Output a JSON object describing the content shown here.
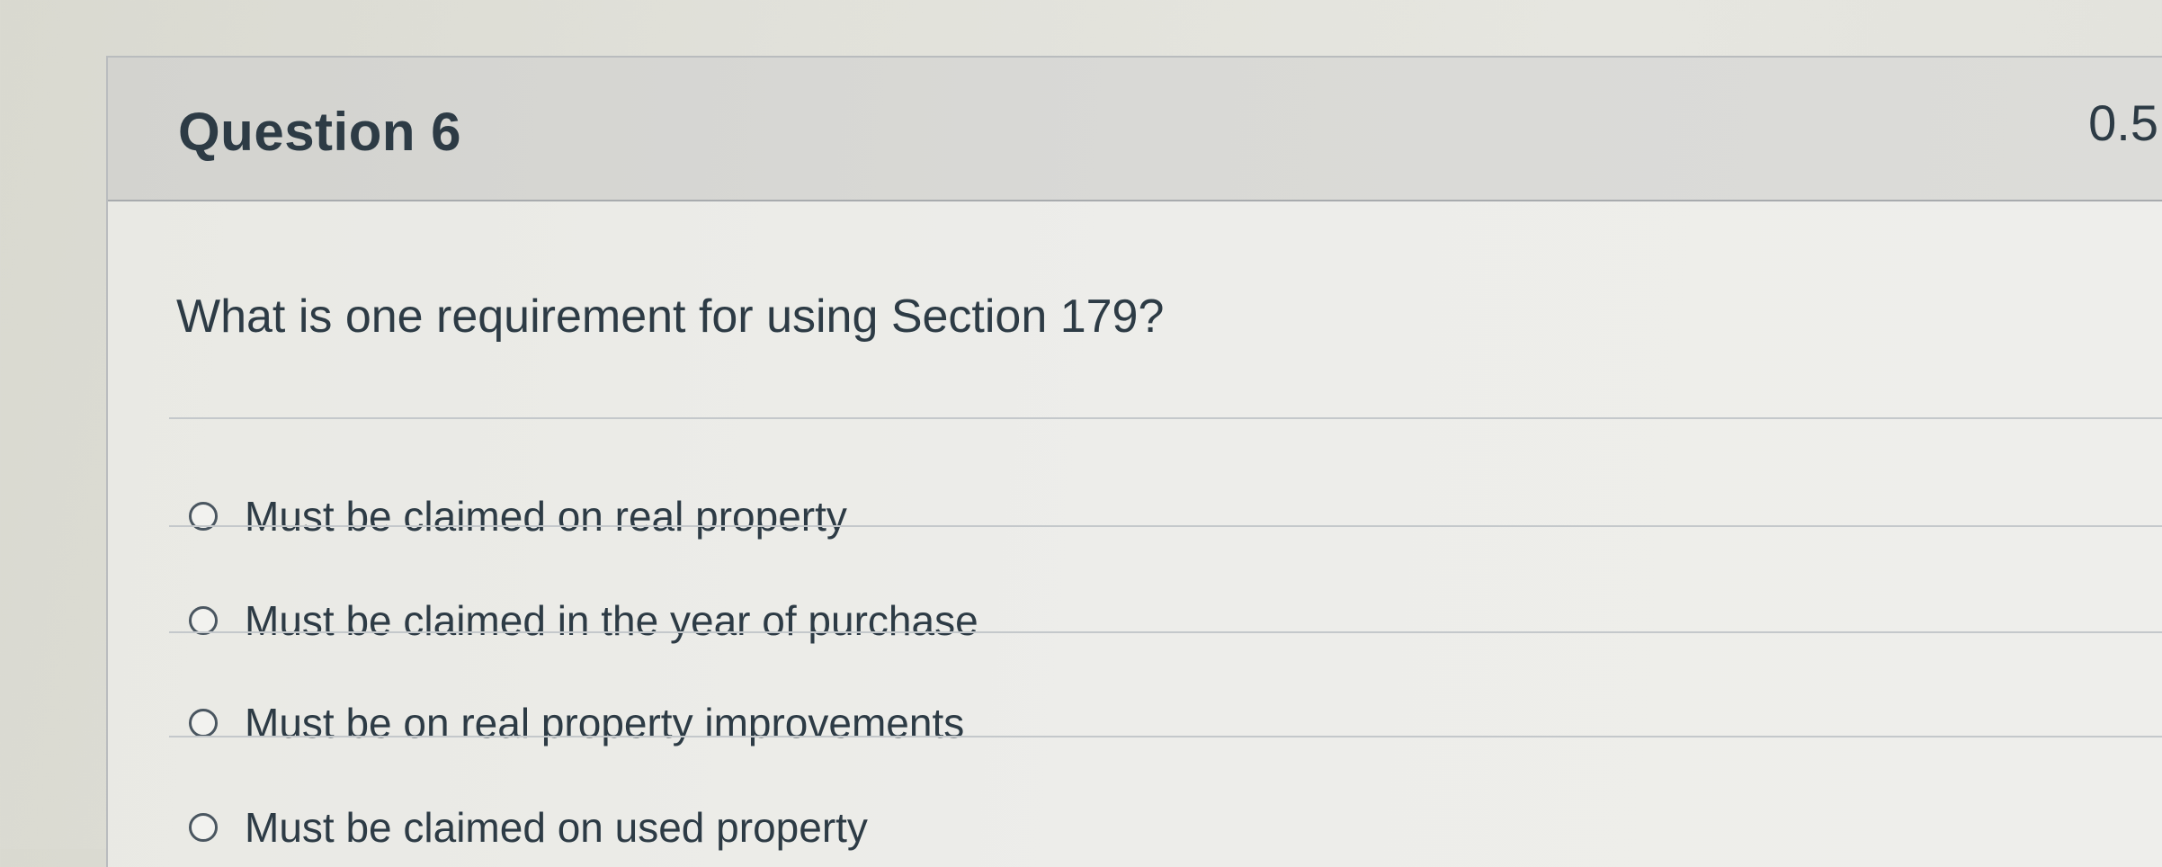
{
  "question": {
    "title": "Question 6",
    "points": "0.5",
    "text": "What is one requirement for using Section 179?"
  },
  "answers": [
    {
      "label": "Must be claimed on real property",
      "selected": false
    },
    {
      "label": "Must be claimed in the year of purchase",
      "selected": false
    },
    {
      "label": "Must be on real property improvements",
      "selected": false
    },
    {
      "label": "Must be claimed on used property",
      "selected": false
    }
  ]
}
